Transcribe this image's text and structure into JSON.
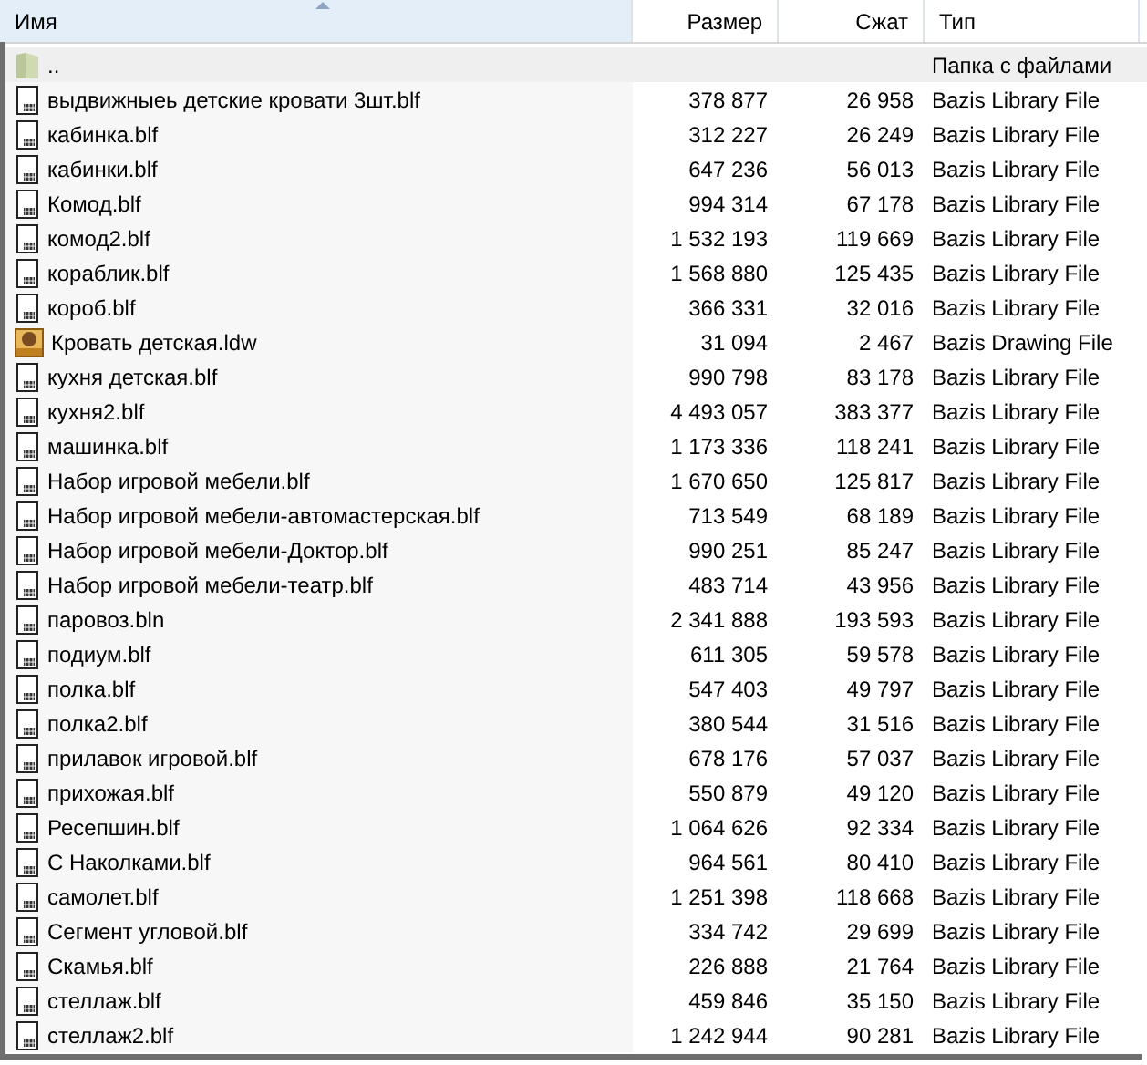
{
  "columns": [
    {
      "label": "Имя",
      "sorted": true
    },
    {
      "label": "Размер",
      "sorted": false
    },
    {
      "label": "Сжат",
      "sorted": false
    },
    {
      "label": "Тип",
      "sorted": false
    }
  ],
  "rows": [
    {
      "kind": "folder",
      "name": "..",
      "type": "Папка с файлами",
      "selected": true
    },
    {
      "kind": "library",
      "name": "выдвижныеь детские кровати 3шт.blf",
      "size": "378 877",
      "packed": "26 958",
      "type": "Bazis Library File",
      "selected": false
    },
    {
      "kind": "library",
      "name": "кабинка.blf",
      "size": "312 227",
      "packed": "26 249",
      "type": "Bazis Library File",
      "selected": false
    },
    {
      "kind": "library",
      "name": "кабинки.blf",
      "size": "647 236",
      "packed": "56 013",
      "type": "Bazis Library File",
      "selected": false
    },
    {
      "kind": "library",
      "name": "Комод.blf",
      "size": "994 314",
      "packed": "67 178",
      "type": "Bazis Library File",
      "selected": false
    },
    {
      "kind": "library",
      "name": "комод2.blf",
      "size": "1 532 193",
      "packed": "119 669",
      "type": "Bazis Library File",
      "selected": false
    },
    {
      "kind": "library",
      "name": "кораблик.blf",
      "size": "1 568 880",
      "packed": "125 435",
      "type": "Bazis Library File",
      "selected": false
    },
    {
      "kind": "library",
      "name": "короб.blf",
      "size": "366 331",
      "packed": "32 016",
      "type": "Bazis Library File",
      "selected": false
    },
    {
      "kind": "drawing",
      "name": "Кровать детская.ldw",
      "size": "31 094",
      "packed": "2 467",
      "type": "Bazis Drawing File",
      "selected": false
    },
    {
      "kind": "library",
      "name": "кухня детская.blf",
      "size": "990 798",
      "packed": "83 178",
      "type": "Bazis Library File",
      "selected": false
    },
    {
      "kind": "library",
      "name": "кухня2.blf",
      "size": "4 493 057",
      "packed": "383 377",
      "type": "Bazis Library File",
      "selected": false
    },
    {
      "kind": "library",
      "name": "машинка.blf",
      "size": "1 173 336",
      "packed": "118 241",
      "type": "Bazis Library File",
      "selected": false
    },
    {
      "kind": "library",
      "name": "Набор игровой мебели.blf",
      "size": "1 670 650",
      "packed": "125 817",
      "type": "Bazis Library File",
      "selected": false
    },
    {
      "kind": "library",
      "name": "Набор игровой мебели-автомастерская.blf",
      "size": "713 549",
      "packed": "68 189",
      "type": "Bazis Library File",
      "selected": false
    },
    {
      "kind": "library",
      "name": "Набор игровой мебели-Доктор.blf",
      "size": "990 251",
      "packed": "85 247",
      "type": "Bazis Library File",
      "selected": false
    },
    {
      "kind": "library",
      "name": "Набор игровой мебели-театр.blf",
      "size": "483 714",
      "packed": "43 956",
      "type": "Bazis Library File",
      "selected": false
    },
    {
      "kind": "library",
      "name": "паровоз.bln",
      "size": "2 341 888",
      "packed": "193 593",
      "type": "Bazis Library File",
      "selected": false
    },
    {
      "kind": "library",
      "name": "подиум.blf",
      "size": "611 305",
      "packed": "59 578",
      "type": "Bazis Library File",
      "selected": false
    },
    {
      "kind": "library",
      "name": "полка.blf",
      "size": "547 403",
      "packed": "49 797",
      "type": "Bazis Library File",
      "selected": false
    },
    {
      "kind": "library",
      "name": "полка2.blf",
      "size": "380 544",
      "packed": "31 516",
      "type": "Bazis Library File",
      "selected": false
    },
    {
      "kind": "library",
      "name": "прилавок игровой.blf",
      "size": "678 176",
      "packed": "57 037",
      "type": "Bazis Library File",
      "selected": false
    },
    {
      "kind": "library",
      "name": "прихожая.blf",
      "size": "550 879",
      "packed": "49 120",
      "type": "Bazis Library File",
      "selected": false
    },
    {
      "kind": "library",
      "name": "Ресепшин.blf",
      "size": "1 064 626",
      "packed": "92 334",
      "type": "Bazis Library File",
      "selected": false
    },
    {
      "kind": "library",
      "name": "С Наколками.blf",
      "size": "964 561",
      "packed": "80 410",
      "type": "Bazis Library File",
      "selected": false
    },
    {
      "kind": "library",
      "name": "самолет.blf",
      "size": "1 251 398",
      "packed": "118 668",
      "type": "Bazis Library File",
      "selected": false
    },
    {
      "kind": "library",
      "name": "Сегмент угловой.blf",
      "size": "334 742",
      "packed": "29 699",
      "type": "Bazis Library File",
      "selected": false
    },
    {
      "kind": "library",
      "name": "Скамья.blf",
      "size": "226 888",
      "packed": "21 764",
      "type": "Bazis Library File",
      "selected": false
    },
    {
      "kind": "library",
      "name": "стеллаж.blf",
      "size": "459 846",
      "packed": "35 150",
      "type": "Bazis Library File",
      "selected": false
    },
    {
      "kind": "library",
      "name": "стеллаж2.blf",
      "size": "1 242 944",
      "packed": "90 281",
      "type": "Bazis Library File",
      "selected": false
    }
  ]
}
